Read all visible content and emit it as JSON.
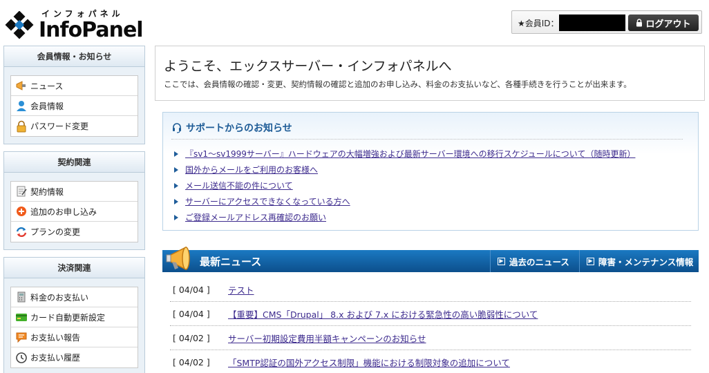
{
  "header": {
    "logo_kana": "インフォパネル",
    "logo_text": "InfoPanel",
    "member_label": "★会員ID：",
    "logout_label": "ログアウト"
  },
  "sidebar": {
    "sections": [
      {
        "title": "会員情報・お知らせ",
        "items": [
          {
            "label": "ニュース",
            "icon": "megaphone-icon"
          },
          {
            "label": "会員情報",
            "icon": "user-icon"
          },
          {
            "label": "パスワード変更",
            "icon": "padlock-icon"
          }
        ]
      },
      {
        "title": "契約関連",
        "items": [
          {
            "label": "契約情報",
            "icon": "contract-icon"
          },
          {
            "label": "追加のお申し込み",
            "icon": "add-circle-icon"
          },
          {
            "label": "プランの変更",
            "icon": "refresh-icon"
          }
        ]
      },
      {
        "title": "決済関連",
        "items": [
          {
            "label": "料金のお支払い",
            "icon": "calculator-icon"
          },
          {
            "label": "カード自動更新設定",
            "icon": "credit-card-icon"
          },
          {
            "label": "お支払い報告",
            "icon": "report-icon"
          },
          {
            "label": "お支払い履歴",
            "icon": "clock-icon"
          }
        ]
      }
    ]
  },
  "welcome": {
    "title": "ようこそ、エックスサーバー・インフォパネルへ",
    "description": "ここでは、会員情報の確認・変更、契約情報の確認と追加のお申し込み、料金のお支払いなど、各種手続きを行うことが出来ます。"
  },
  "support": {
    "title": "サポートからのお知らせ",
    "links": [
      "『sv1～sv1999サーバー』ハードウェアの大幅増強および最新サーバー環境への移行スケジュールについて（随時更新）",
      "国外からメールをご利用のお客様へ",
      "メール送信不能の件について",
      "サーバーにアクセスできなくなっている方へ",
      "ご登録メールアドレス再確認のお願い"
    ]
  },
  "news": {
    "title": "最新ニュース",
    "past_label": "過去のニュース",
    "maintenance_label": "障害・メンテナンス情報",
    "rows": [
      {
        "date": "[ 04/04 ]",
        "title": "テスト"
      },
      {
        "date": "[ 04/04 ]",
        "title": "【重要】CMS「Drupal」 8.x および 7.x における緊急性の高い脆弱性について"
      },
      {
        "date": "[ 04/02 ]",
        "title": "サーバー初期設定費用半額キャンペーンのお知らせ"
      },
      {
        "date": "[ 04/02 ]",
        "title": "「SMTP認証の国外アクセス制限」機能における制限対象の追加について"
      }
    ]
  },
  "colors": {
    "brand_blue": "#0c4f8c",
    "link": "#3d2b8e",
    "support_title": "#1d5b96"
  }
}
